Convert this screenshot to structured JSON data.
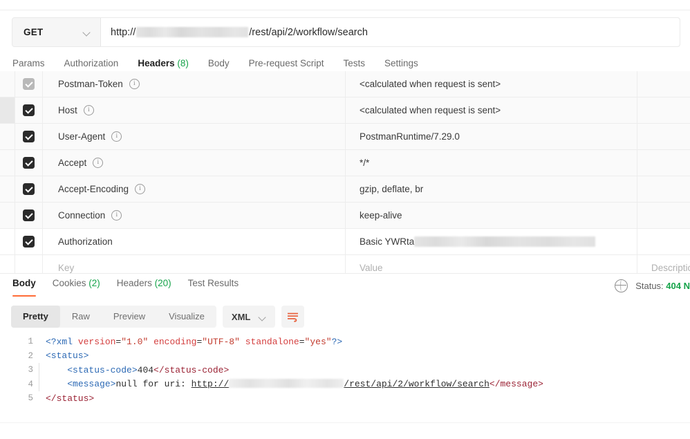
{
  "request": {
    "method": "GET",
    "method_icon": "chevron-down-icon",
    "url_prefix": "http://",
    "url_redacted": true,
    "url_suffix": "/rest/api/2/workflow/search",
    "tabs": [
      {
        "label": "Params",
        "count": "",
        "active": false
      },
      {
        "label": "Authorization",
        "count": "",
        "active": false
      },
      {
        "label": "Headers",
        "count": "(8)",
        "active": true
      },
      {
        "label": "Body",
        "count": "",
        "active": false
      },
      {
        "label": "Pre-request Script",
        "count": "",
        "active": false
      },
      {
        "label": "Tests",
        "count": "",
        "active": false
      },
      {
        "label": "Settings",
        "count": "",
        "active": false
      }
    ]
  },
  "headers_table": {
    "columns": {
      "key": "Key",
      "value": "Value",
      "description": "Description"
    },
    "rows": [
      {
        "key": "Postman-Token",
        "value": "<calculated when request is sent>",
        "description": "",
        "checked": true,
        "info": true,
        "partial": true
      },
      {
        "key": "Host",
        "value": "<calculated when request is sent>",
        "description": "",
        "checked": true,
        "info": true,
        "hovered": true
      },
      {
        "key": "User-Agent",
        "value": "PostmanRuntime/7.29.0",
        "description": "",
        "checked": true,
        "info": true
      },
      {
        "key": "Accept",
        "value": "*/*",
        "description": "",
        "checked": true,
        "info": true
      },
      {
        "key": "Accept-Encoding",
        "value": "gzip, deflate, br",
        "description": "",
        "checked": true,
        "info": true
      },
      {
        "key": "Connection",
        "value": "keep-alive",
        "description": "",
        "checked": true,
        "info": true
      },
      {
        "key": "Authorization",
        "value": "Basic YWRta",
        "value_redacted": true,
        "description": "",
        "checked": true,
        "info": false,
        "plain": true
      }
    ]
  },
  "response": {
    "tabs": [
      {
        "label": "Body",
        "count": "",
        "active": true
      },
      {
        "label": "Cookies",
        "count": "(2)",
        "active": false
      },
      {
        "label": "Headers",
        "count": "(20)",
        "active": false
      },
      {
        "label": "Test Results",
        "count": "",
        "active": false
      }
    ],
    "status_icon": "globe-icon",
    "status_label": "Status:",
    "status_value": "404 N",
    "view_modes": [
      {
        "label": "Pretty",
        "active": true
      },
      {
        "label": "Raw",
        "active": false
      },
      {
        "label": "Preview",
        "active": false
      },
      {
        "label": "Visualize",
        "active": false
      }
    ],
    "language": "XML",
    "language_icon": "chevron-down-icon",
    "wrap_icon": "wrap-text-icon",
    "code": {
      "lines": [
        {
          "n": "1"
        },
        {
          "n": "2"
        },
        {
          "n": "3"
        },
        {
          "n": "4"
        },
        {
          "n": "5"
        }
      ],
      "line1": {
        "open": "<?xml ",
        "attr1": "version",
        "eq1": "=",
        "val1": "\"1.0\"",
        "attr2": "encoding",
        "eq2": "=",
        "val2": "\"UTF-8\"",
        "attr3": "standalone",
        "eq3": "=",
        "val3": "\"yes\"",
        "close": "?>"
      },
      "line2": {
        "tag": "<status>"
      },
      "line3": {
        "open": "<status-code>",
        "text": "404",
        "close": "</status-code>"
      },
      "line4": {
        "open": "<message>",
        "text": "null for uri: ",
        "link_prefix": "http://",
        "link_suffix": "/rest/api/2/workflow/search",
        "close": "</message>"
      },
      "line5": {
        "tag": "</status>"
      }
    }
  },
  "colors": {
    "accent": "#ff6c37",
    "success": "#16a34a",
    "tag": "#2d6ab5",
    "tag_close": "#9b2335",
    "attr": "#d43f3f",
    "value": "#c23b2e"
  }
}
